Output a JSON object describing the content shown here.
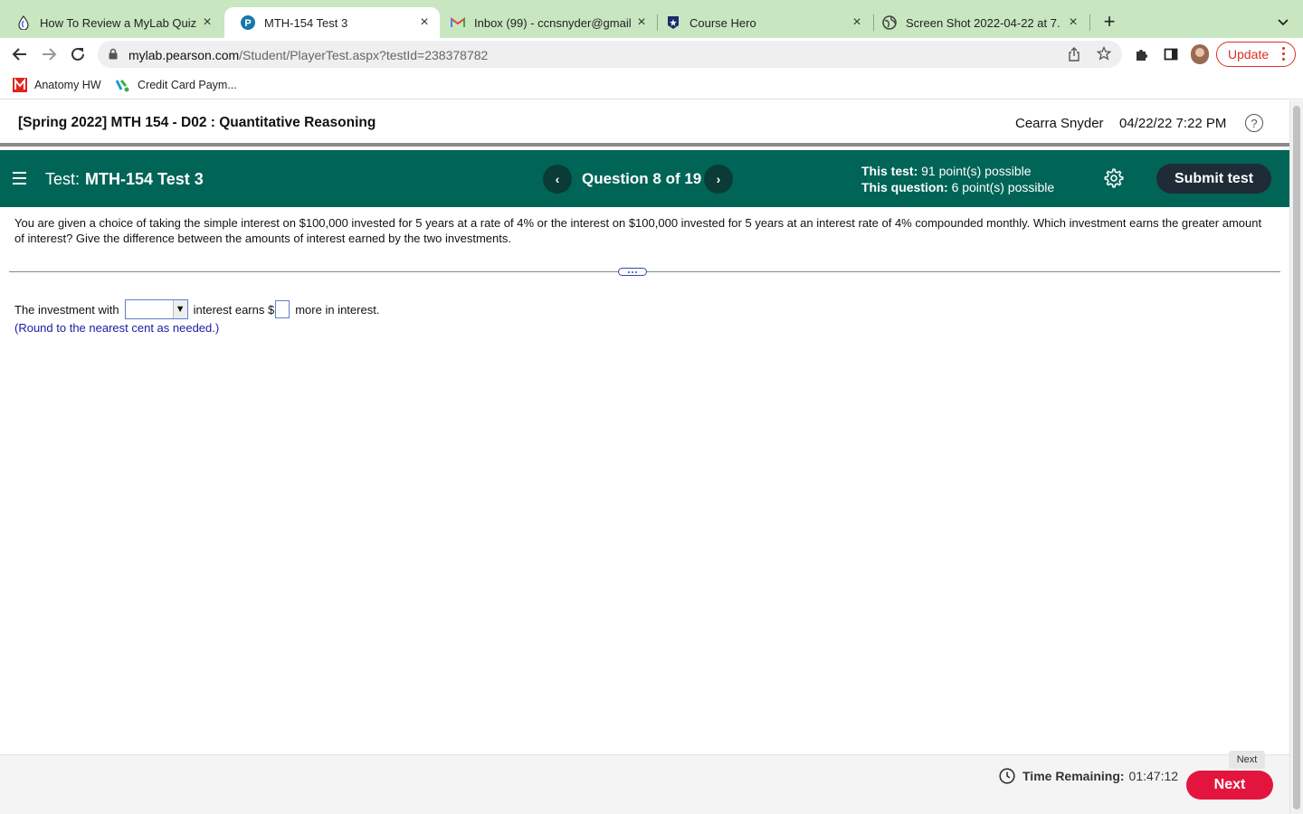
{
  "browser": {
    "tabs": [
      {
        "title": "How To Review a MyLab Quiz.c",
        "icon": "pearson-drop-icon"
      },
      {
        "title": "MTH-154 Test 3",
        "icon": "pearson-p-icon"
      },
      {
        "title": "Inbox (99) - ccnsnyder@gmail",
        "icon": "gmail-icon"
      },
      {
        "title": "Course Hero",
        "icon": "course-hero-icon"
      },
      {
        "title": "Screen Shot 2022-04-22 at 7.",
        "icon": "globe-icon"
      }
    ],
    "tab_close_glyph": "×",
    "new_tab_glyph": "+",
    "url_host": "mylab.pearson.com",
    "url_path": "/Student/PlayerTest.aspx?testId=238378782",
    "update_label": "Update",
    "bookmarks": [
      {
        "label": "Anatomy HW",
        "icon": "mcgraw-hill-icon"
      },
      {
        "label": "Credit Card Paym...",
        "icon": "credit-card-icon"
      }
    ]
  },
  "header": {
    "course_title": "[Spring 2022] MTH 154 - D02 : Quantitative Reasoning",
    "student_name": "Cearra Snyder",
    "date_time": "04/22/22 7:22 PM",
    "help_glyph": "?"
  },
  "testbar": {
    "test_prefix": "Test:",
    "test_name": "MTH-154 Test 3",
    "prev_glyph": "‹",
    "next_glyph": "›",
    "question_counter": "Question 8 of 19",
    "this_test_label": "This test:",
    "this_test_value": "91 point(s) possible",
    "this_question_label": "This question:",
    "this_question_value": "6 point(s) possible",
    "submit_label": "Submit test"
  },
  "question": {
    "text": "You are given a choice of taking the simple interest on $100,000 invested for 5 years at a rate of 4% or the interest on $100,000 invested for 5 years at an interest rate of 4% compounded monthly. Which investment earns the greater amount of interest? Give the difference between the amounts of interest earned by the two investments.",
    "answer_prefix": "The investment with",
    "answer_middle": "interest earns $",
    "answer_suffix": "more in interest.",
    "dropdown_value": "",
    "dropdown_arrow": "▼",
    "amount_value": "",
    "round_note": "(Round to the nearest cent as needed.)"
  },
  "footer": {
    "time_label": "Time Remaining:",
    "time_value": "01:47:12",
    "next_tooltip": "Next",
    "next_label": "Next"
  }
}
